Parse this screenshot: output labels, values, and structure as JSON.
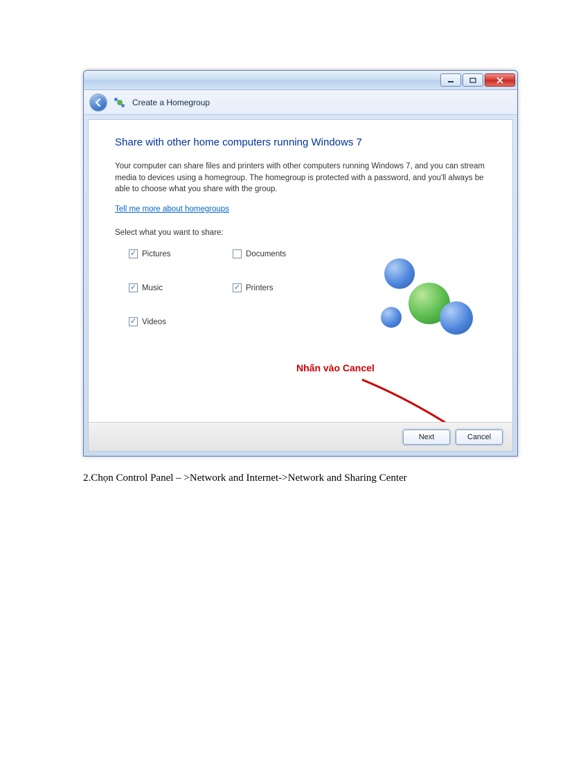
{
  "window": {
    "title": "Create a Homegroup",
    "heading": "Share with other home computers running Windows 7",
    "description": "Your computer can share files and printers with other computers running Windows 7, and you can stream media to devices using a homegroup. The homegroup is protected with a password, and you'll always be able to choose what you share with the group.",
    "link": "Tell me more about homegroups",
    "selectLabel": "Select what you want to share:",
    "checks": {
      "pictures": {
        "label": "Pictures",
        "checked": true
      },
      "documents": {
        "label": "Documents",
        "checked": false
      },
      "music": {
        "label": "Music",
        "checked": true
      },
      "printers": {
        "label": "Printers",
        "checked": true
      },
      "videos": {
        "label": "Videos",
        "checked": true
      }
    },
    "annotation": "Nhấn vào Cancel",
    "buttons": {
      "next": "Next",
      "cancel": "Cancel"
    }
  },
  "caption": "2.Chọn Control Panel – >Network and Internet->Network and Sharing Center"
}
